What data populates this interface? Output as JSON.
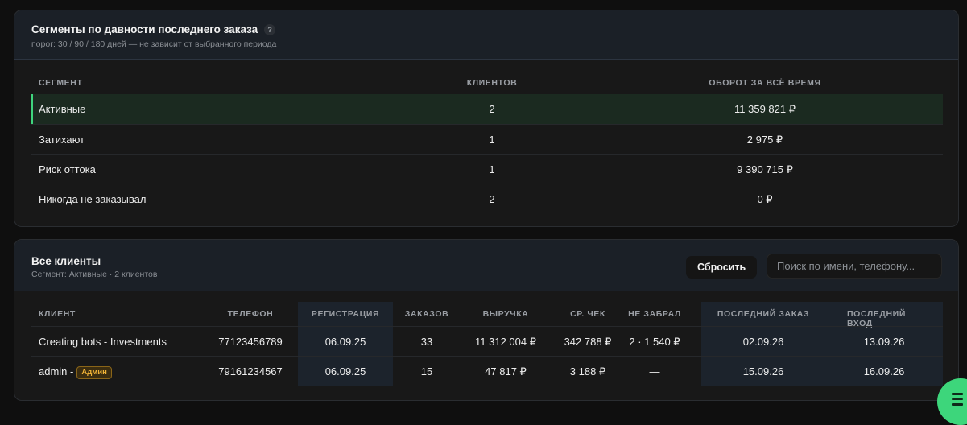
{
  "segments": {
    "title": "Сегменты по давности последнего заказа",
    "help": "?",
    "subtitle": "порог: 30 / 90 / 180 дней — не зависит от выбранного периода",
    "headers": {
      "segment": "Сегмент",
      "clients": "Клиентов",
      "turnover": "Оборот за всё время"
    },
    "rows": [
      {
        "name": "Активные",
        "clients": "2",
        "turnover": "11 359 821 ₽"
      },
      {
        "name": "Затихают",
        "clients": "1",
        "turnover": "2 975 ₽"
      },
      {
        "name": "Риск оттока",
        "clients": "1",
        "turnover": "9 390 715 ₽"
      },
      {
        "name": "Никогда не заказывал",
        "clients": "2",
        "turnover": "0 ₽"
      }
    ]
  },
  "clients": {
    "title": "Все клиенты",
    "subtitle": "Сегмент: Активные · 2 клиентов",
    "reset_label": "Сбросить",
    "search_placeholder": "Поиск по имени, телефону...",
    "headers": {
      "client": "Клиент",
      "phone": "Телефон",
      "registration": "Регистрация",
      "orders": "Заказов",
      "revenue": "Выручка",
      "avg_check": "Ср. чек",
      "not_picked": "Не забрал",
      "last_order": "Последний заказ",
      "last_login": "Последний вход"
    },
    "rows": [
      {
        "name": "Creating bots - Investments",
        "badge": "",
        "phone": "77123456789",
        "registration": "06.09.25",
        "orders": "33",
        "revenue": "11 312 004 ₽",
        "avg_check": "342 788 ₽",
        "not_picked": "2 · 1 540 ₽",
        "last_order": "02.09.26",
        "last_login": "13.09.26"
      },
      {
        "name": "admin -",
        "badge": "Админ",
        "phone": "79161234567",
        "registration": "06.09.25",
        "orders": "15",
        "revenue": "47 817 ₽",
        "avg_check": "3 188 ₽",
        "not_picked": "—",
        "last_order": "15.09.26",
        "last_login": "16.09.26"
      }
    ]
  },
  "colors": {
    "accent": "#3fd57d",
    "admin_badge": "#f2b437",
    "header_bg": "#1b2027"
  },
  "icons": {
    "fab": "menu-icon",
    "help": "help-icon"
  }
}
